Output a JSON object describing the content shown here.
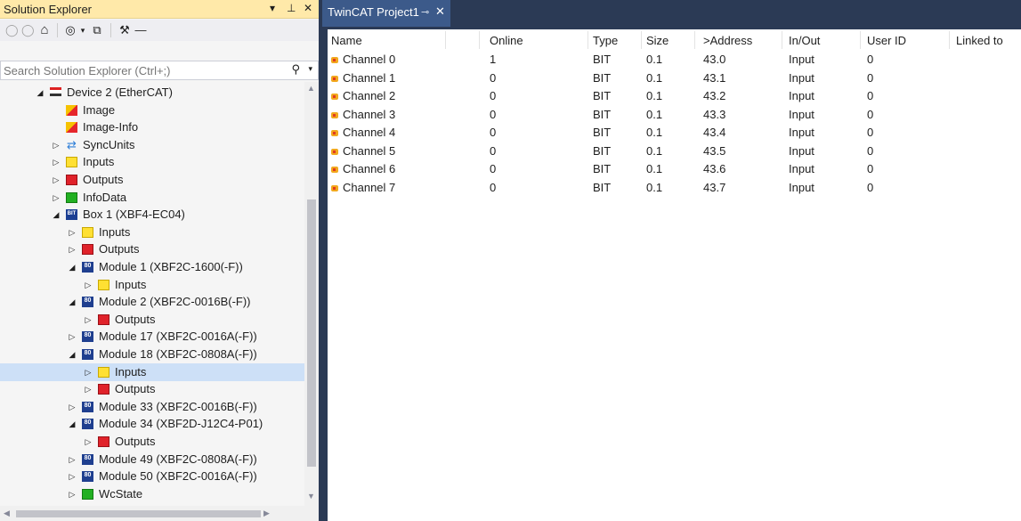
{
  "solution_explorer": {
    "title": "Solution Explorer",
    "title_controls": {
      "dropdown": "▾",
      "pin": "⊥",
      "close": "✕"
    },
    "toolbar": {
      "back": "◯",
      "forward": "◯",
      "home": "⌂",
      "history": "◎",
      "history_dropdown": "▾",
      "collapse": "⧉",
      "properties": "⚒",
      "preview": "—"
    },
    "search": {
      "placeholder": "Search Solution Explorer (Ctrl+;)",
      "icon": "⚲",
      "dropdown": "▾"
    },
    "tree": [
      {
        "label": "Device 2 (EtherCAT)",
        "icon": "ethercat-device-icon",
        "expanded": true
      },
      {
        "label": "Image",
        "icon": "image-icon"
      },
      {
        "label": "Image-Info",
        "icon": "image-icon"
      },
      {
        "label": "SyncUnits",
        "icon": "sync-icon",
        "expanded": false
      },
      {
        "label": "Inputs",
        "icon": "inputs-icon",
        "expanded": false
      },
      {
        "label": "Outputs",
        "icon": "outputs-icon",
        "expanded": false
      },
      {
        "label": "InfoData",
        "icon": "infodata-icon",
        "expanded": false
      },
      {
        "label": "Box 1 (XBF4-EC04)",
        "icon": "box-icon",
        "expanded": true
      },
      {
        "label": "Inputs",
        "icon": "inputs-icon",
        "expanded": false
      },
      {
        "label": "Outputs",
        "icon": "outputs-icon",
        "expanded": false
      },
      {
        "label": "Module 1 (XBF2C-1600(-F))",
        "icon": "module-icon",
        "expanded": true
      },
      {
        "label": "Inputs",
        "icon": "inputs-icon",
        "expanded": false
      },
      {
        "label": "Module 2 (XBF2C-0016B(-F))",
        "icon": "module-icon",
        "expanded": true
      },
      {
        "label": "Outputs",
        "icon": "outputs-icon",
        "expanded": false
      },
      {
        "label": "Module 17 (XBF2C-0016A(-F))",
        "icon": "module-icon",
        "expanded": false
      },
      {
        "label": "Module 18 (XBF2C-0808A(-F))",
        "icon": "module-icon",
        "expanded": true
      },
      {
        "label": "Inputs",
        "icon": "inputs-icon",
        "expanded": false,
        "selected": true
      },
      {
        "label": "Outputs",
        "icon": "outputs-icon",
        "expanded": false
      },
      {
        "label": "Module 33 (XBF2C-0016B(-F))",
        "icon": "module-icon",
        "expanded": false
      },
      {
        "label": "Module 34 (XBF2D-J12C4-P01)",
        "icon": "module-icon",
        "expanded": true
      },
      {
        "label": "Outputs",
        "icon": "outputs-icon",
        "expanded": false
      },
      {
        "label": "Module 49 (XBF2C-0808A(-F))",
        "icon": "module-icon",
        "expanded": false
      },
      {
        "label": "Module 50 (XBF2C-0016A(-F))",
        "icon": "module-icon",
        "expanded": false
      },
      {
        "label": "WcState",
        "icon": "wcstate-icon",
        "expanded": false
      }
    ],
    "scroll_glyphs": {
      "up": "▲",
      "down": "▼",
      "left": "◀",
      "right": "▶"
    },
    "expander_glyphs": {
      "expanded": "◢",
      "collapsed": "▷"
    },
    "module_icon_text": "80",
    "box_icon_text": "BIT"
  },
  "document": {
    "tab": {
      "title": "TwinCAT Project1",
      "pin": "⊸",
      "close": "✕"
    },
    "grid": {
      "columns": [
        "Name",
        "Online",
        "Type",
        "Size",
        ">Address",
        "In/Out",
        "User ID",
        "Linked to"
      ],
      "rows": [
        {
          "name": "Channel 0",
          "online": "1",
          "type": "BIT",
          "size": "0.1",
          "address": "43.0",
          "inout": "Input",
          "user_id": "0"
        },
        {
          "name": "Channel 1",
          "online": "0",
          "type": "BIT",
          "size": "0.1",
          "address": "43.1",
          "inout": "Input",
          "user_id": "0"
        },
        {
          "name": "Channel 2",
          "online": "0",
          "type": "BIT",
          "size": "0.1",
          "address": "43.2",
          "inout": "Input",
          "user_id": "0"
        },
        {
          "name": "Channel 3",
          "online": "0",
          "type": "BIT",
          "size": "0.1",
          "address": "43.3",
          "inout": "Input",
          "user_id": "0"
        },
        {
          "name": "Channel 4",
          "online": "0",
          "type": "BIT",
          "size": "0.1",
          "address": "43.4",
          "inout": "Input",
          "user_id": "0"
        },
        {
          "name": "Channel 5",
          "online": "0",
          "type": "BIT",
          "size": "0.1",
          "address": "43.5",
          "inout": "Input",
          "user_id": "0"
        },
        {
          "name": "Channel 6",
          "online": "0",
          "type": "BIT",
          "size": "0.1",
          "address": "43.6",
          "inout": "Input",
          "user_id": "0"
        },
        {
          "name": "Channel 7",
          "online": "0",
          "type": "BIT",
          "size": "0.1",
          "address": "43.7",
          "inout": "Input",
          "user_id": "0"
        }
      ]
    }
  },
  "colors": {
    "title_active": "#ffe9a9",
    "selection": "#cde0f7",
    "doc_tab": "#3c5a8a",
    "frame": "#2b3a55"
  }
}
